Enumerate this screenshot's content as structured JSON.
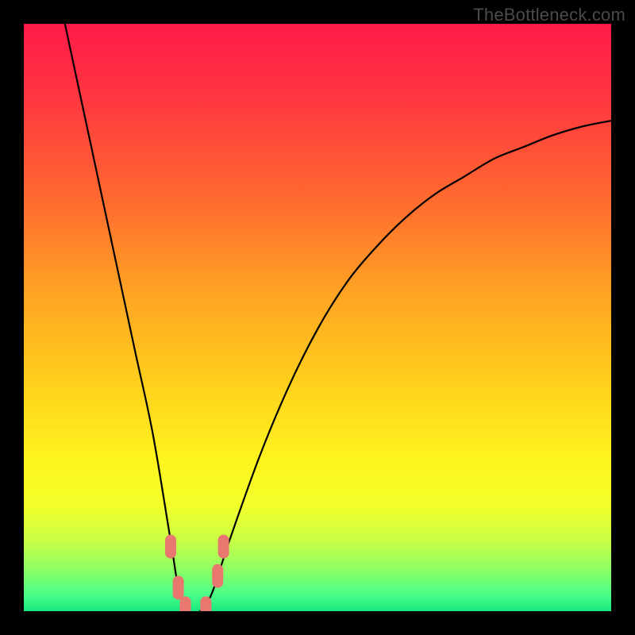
{
  "watermark": "TheBottleneck.com",
  "chart_data": {
    "type": "line",
    "title": "",
    "xlabel": "",
    "ylabel": "",
    "xlim": [
      0,
      100
    ],
    "ylim": [
      0,
      100
    ],
    "grid": false,
    "legend": false,
    "annotations": [],
    "series": [
      {
        "name": "bottleneck-curve",
        "comment": "V-shaped bottleneck percentage curve; y estimated from visual height (0 = bottom/green, 100 = top/red)",
        "x": [
          7,
          10,
          13,
          16,
          19,
          22,
          25,
          26.5,
          28,
          30,
          32,
          35,
          40,
          45,
          50,
          55,
          60,
          65,
          70,
          75,
          80,
          85,
          90,
          95,
          100
        ],
        "y": [
          100,
          86,
          72,
          58,
          44,
          30,
          12,
          3,
          0,
          0,
          3,
          12,
          26,
          38,
          48,
          56,
          62,
          67,
          71,
          74,
          77,
          79,
          81,
          82.5,
          83.5
        ]
      }
    ],
    "markers": [
      {
        "name": "highlight-points",
        "comment": "Salmon rounded markers near curve minimum",
        "color": "#e8776f",
        "points": [
          {
            "x": 25.0,
            "y": 11
          },
          {
            "x": 26.3,
            "y": 4
          },
          {
            "x": 27.5,
            "y": 0.5
          },
          {
            "x": 31.0,
            "y": 0.5
          },
          {
            "x": 33.0,
            "y": 6
          },
          {
            "x": 34.0,
            "y": 11
          }
        ]
      }
    ],
    "background_gradient": {
      "stops": [
        {
          "pos": 0.0,
          "color": "#ff1a49"
        },
        {
          "pos": 0.14,
          "color": "#ff3a3f"
        },
        {
          "pos": 0.3,
          "color": "#ff6a2f"
        },
        {
          "pos": 0.46,
          "color": "#ffa423"
        },
        {
          "pos": 0.62,
          "color": "#ffd21c"
        },
        {
          "pos": 0.74,
          "color": "#fff31e"
        },
        {
          "pos": 0.82,
          "color": "#f3ff2a"
        },
        {
          "pos": 0.88,
          "color": "#c8ff45"
        },
        {
          "pos": 0.93,
          "color": "#8cff66"
        },
        {
          "pos": 0.97,
          "color": "#4dff88"
        },
        {
          "pos": 1.0,
          "color": "#18e880"
        }
      ]
    }
  }
}
